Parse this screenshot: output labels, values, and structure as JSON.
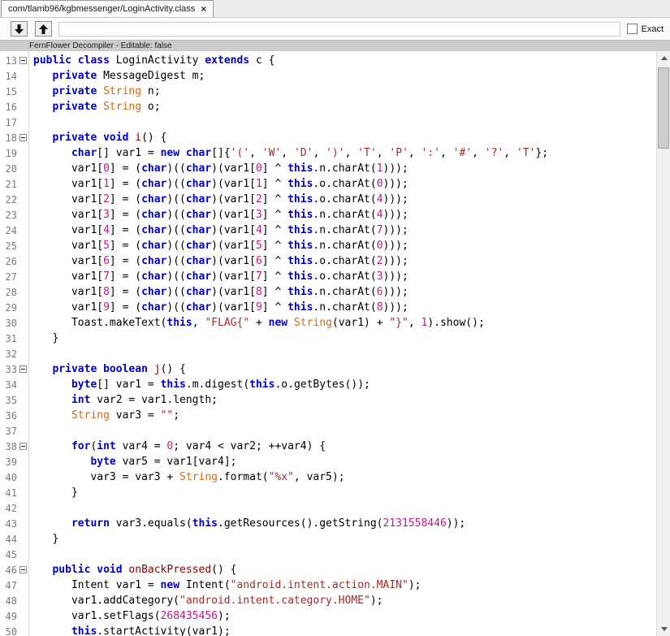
{
  "tab": {
    "title": "com/tlamb96/kgbmessenger/LoginActivity.class",
    "close_glyph": "×"
  },
  "toolbar": {
    "search_value": "",
    "exact_label": "Exact",
    "exact_checked": false
  },
  "decompiler_bar": {
    "label": "FernFlower Decompiler - Editable: false"
  },
  "syntax_colors": {
    "k": "#0000CC",
    "t": "#D2691E",
    "f": "#8B0000",
    "n": "#C71585",
    "s": "#A52A2A",
    "p": "#000000"
  },
  "editor": {
    "first_line": 13,
    "fold_lines": [
      13,
      18,
      33,
      38,
      46
    ],
    "lines": [
      [
        [
          "k",
          "public"
        ],
        [
          "p",
          " "
        ],
        [
          "k",
          "class"
        ],
        [
          "p",
          " LoginActivity "
        ],
        [
          "k",
          "extends"
        ],
        [
          "p",
          " c {"
        ]
      ],
      [
        [
          "p",
          "   "
        ],
        [
          "k",
          "private"
        ],
        [
          "p",
          " MessageDigest m;"
        ]
      ],
      [
        [
          "p",
          "   "
        ],
        [
          "k",
          "private"
        ],
        [
          "p",
          " "
        ],
        [
          "t",
          "String"
        ],
        [
          "p",
          " n;"
        ]
      ],
      [
        [
          "p",
          "   "
        ],
        [
          "k",
          "private"
        ],
        [
          "p",
          " "
        ],
        [
          "t",
          "String"
        ],
        [
          "p",
          " o;"
        ]
      ],
      [],
      [
        [
          "p",
          "   "
        ],
        [
          "k",
          "private"
        ],
        [
          "p",
          " "
        ],
        [
          "k",
          "void"
        ],
        [
          "p",
          " "
        ],
        [
          "f",
          "i"
        ],
        [
          "p",
          "() {"
        ]
      ],
      [
        [
          "p",
          "      "
        ],
        [
          "k",
          "char"
        ],
        [
          "p",
          "[] var1 = "
        ],
        [
          "k",
          "new"
        ],
        [
          "p",
          " "
        ],
        [
          "k",
          "char"
        ],
        [
          "p",
          "[]{"
        ],
        [
          "c",
          "'('"
        ],
        [
          "p",
          ", "
        ],
        [
          "c",
          "'W'"
        ],
        [
          "p",
          ", "
        ],
        [
          "c",
          "'D'"
        ],
        [
          "p",
          ", "
        ],
        [
          "c",
          "')'"
        ],
        [
          "p",
          ", "
        ],
        [
          "c",
          "'T'"
        ],
        [
          "p",
          ", "
        ],
        [
          "c",
          "'P'"
        ],
        [
          "p",
          ", "
        ],
        [
          "c",
          "':'"
        ],
        [
          "p",
          ", "
        ],
        [
          "c",
          "'#'"
        ],
        [
          "p",
          ", "
        ],
        [
          "c",
          "'?'"
        ],
        [
          "p",
          ", "
        ],
        [
          "c",
          "'T'"
        ],
        [
          "p",
          "};"
        ]
      ],
      [
        [
          "p",
          "      var1["
        ],
        [
          "n",
          "0"
        ],
        [
          "p",
          "] = ("
        ],
        [
          "k",
          "char"
        ],
        [
          "p",
          ")(("
        ],
        [
          "k",
          "char"
        ],
        [
          "p",
          ")(var1["
        ],
        [
          "n",
          "0"
        ],
        [
          "p",
          "] ^ "
        ],
        [
          "k",
          "this"
        ],
        [
          "p",
          ".n.charAt("
        ],
        [
          "n",
          "1"
        ],
        [
          "p",
          ")));"
        ]
      ],
      [
        [
          "p",
          "      var1["
        ],
        [
          "n",
          "1"
        ],
        [
          "p",
          "] = ("
        ],
        [
          "k",
          "char"
        ],
        [
          "p",
          ")(("
        ],
        [
          "k",
          "char"
        ],
        [
          "p",
          ")(var1["
        ],
        [
          "n",
          "1"
        ],
        [
          "p",
          "] ^ "
        ],
        [
          "k",
          "this"
        ],
        [
          "p",
          ".o.charAt("
        ],
        [
          "n",
          "0"
        ],
        [
          "p",
          ")));"
        ]
      ],
      [
        [
          "p",
          "      var1["
        ],
        [
          "n",
          "2"
        ],
        [
          "p",
          "] = ("
        ],
        [
          "k",
          "char"
        ],
        [
          "p",
          ")(("
        ],
        [
          "k",
          "char"
        ],
        [
          "p",
          ")(var1["
        ],
        [
          "n",
          "2"
        ],
        [
          "p",
          "] ^ "
        ],
        [
          "k",
          "this"
        ],
        [
          "p",
          ".o.charAt("
        ],
        [
          "n",
          "4"
        ],
        [
          "p",
          ")));"
        ]
      ],
      [
        [
          "p",
          "      var1["
        ],
        [
          "n",
          "3"
        ],
        [
          "p",
          "] = ("
        ],
        [
          "k",
          "char"
        ],
        [
          "p",
          ")(("
        ],
        [
          "k",
          "char"
        ],
        [
          "p",
          ")(var1["
        ],
        [
          "n",
          "3"
        ],
        [
          "p",
          "] ^ "
        ],
        [
          "k",
          "this"
        ],
        [
          "p",
          ".n.charAt("
        ],
        [
          "n",
          "4"
        ],
        [
          "p",
          ")));"
        ]
      ],
      [
        [
          "p",
          "      var1["
        ],
        [
          "n",
          "4"
        ],
        [
          "p",
          "] = ("
        ],
        [
          "k",
          "char"
        ],
        [
          "p",
          ")(("
        ],
        [
          "k",
          "char"
        ],
        [
          "p",
          ")(var1["
        ],
        [
          "n",
          "4"
        ],
        [
          "p",
          "] ^ "
        ],
        [
          "k",
          "this"
        ],
        [
          "p",
          ".n.charAt("
        ],
        [
          "n",
          "7"
        ],
        [
          "p",
          ")));"
        ]
      ],
      [
        [
          "p",
          "      var1["
        ],
        [
          "n",
          "5"
        ],
        [
          "p",
          "] = ("
        ],
        [
          "k",
          "char"
        ],
        [
          "p",
          ")(("
        ],
        [
          "k",
          "char"
        ],
        [
          "p",
          ")(var1["
        ],
        [
          "n",
          "5"
        ],
        [
          "p",
          "] ^ "
        ],
        [
          "k",
          "this"
        ],
        [
          "p",
          ".n.charAt("
        ],
        [
          "n",
          "0"
        ],
        [
          "p",
          ")));"
        ]
      ],
      [
        [
          "p",
          "      var1["
        ],
        [
          "n",
          "6"
        ],
        [
          "p",
          "] = ("
        ],
        [
          "k",
          "char"
        ],
        [
          "p",
          ")(("
        ],
        [
          "k",
          "char"
        ],
        [
          "p",
          ")(var1["
        ],
        [
          "n",
          "6"
        ],
        [
          "p",
          "] ^ "
        ],
        [
          "k",
          "this"
        ],
        [
          "p",
          ".o.charAt("
        ],
        [
          "n",
          "2"
        ],
        [
          "p",
          ")));"
        ]
      ],
      [
        [
          "p",
          "      var1["
        ],
        [
          "n",
          "7"
        ],
        [
          "p",
          "] = ("
        ],
        [
          "k",
          "char"
        ],
        [
          "p",
          ")(("
        ],
        [
          "k",
          "char"
        ],
        [
          "p",
          ")(var1["
        ],
        [
          "n",
          "7"
        ],
        [
          "p",
          "] ^ "
        ],
        [
          "k",
          "this"
        ],
        [
          "p",
          ".o.charAt("
        ],
        [
          "n",
          "3"
        ],
        [
          "p",
          ")));"
        ]
      ],
      [
        [
          "p",
          "      var1["
        ],
        [
          "n",
          "8"
        ],
        [
          "p",
          "] = ("
        ],
        [
          "k",
          "char"
        ],
        [
          "p",
          ")(("
        ],
        [
          "k",
          "char"
        ],
        [
          "p",
          ")(var1["
        ],
        [
          "n",
          "8"
        ],
        [
          "p",
          "] ^ "
        ],
        [
          "k",
          "this"
        ],
        [
          "p",
          ".n.charAt("
        ],
        [
          "n",
          "6"
        ],
        [
          "p",
          ")));"
        ]
      ],
      [
        [
          "p",
          "      var1["
        ],
        [
          "n",
          "9"
        ],
        [
          "p",
          "] = ("
        ],
        [
          "k",
          "char"
        ],
        [
          "p",
          ")(("
        ],
        [
          "k",
          "char"
        ],
        [
          "p",
          ")(var1["
        ],
        [
          "n",
          "9"
        ],
        [
          "p",
          "] ^ "
        ],
        [
          "k",
          "this"
        ],
        [
          "p",
          ".n.charAt("
        ],
        [
          "n",
          "8"
        ],
        [
          "p",
          ")));"
        ]
      ],
      [
        [
          "p",
          "      Toast.makeText("
        ],
        [
          "k",
          "this"
        ],
        [
          "p",
          ", "
        ],
        [
          "s",
          "\"FLAG{\""
        ],
        [
          "p",
          " + "
        ],
        [
          "k",
          "new"
        ],
        [
          "p",
          " "
        ],
        [
          "t",
          "String"
        ],
        [
          "p",
          "(var1) + "
        ],
        [
          "s",
          "\"}\""
        ],
        [
          "p",
          ", "
        ],
        [
          "n",
          "1"
        ],
        [
          "p",
          ").show();"
        ]
      ],
      [
        [
          "p",
          "   }"
        ]
      ],
      [],
      [
        [
          "p",
          "   "
        ],
        [
          "k",
          "private"
        ],
        [
          "p",
          " "
        ],
        [
          "k",
          "boolean"
        ],
        [
          "p",
          " "
        ],
        [
          "f",
          "j"
        ],
        [
          "p",
          "() {"
        ]
      ],
      [
        [
          "p",
          "      "
        ],
        [
          "k",
          "byte"
        ],
        [
          "p",
          "[] var1 = "
        ],
        [
          "k",
          "this"
        ],
        [
          "p",
          ".m.digest("
        ],
        [
          "k",
          "this"
        ],
        [
          "p",
          ".o.getBytes());"
        ]
      ],
      [
        [
          "p",
          "      "
        ],
        [
          "k",
          "int"
        ],
        [
          "p",
          " var2 = var1.length;"
        ]
      ],
      [
        [
          "p",
          "      "
        ],
        [
          "t",
          "String"
        ],
        [
          "p",
          " var3 = "
        ],
        [
          "s",
          "\"\""
        ],
        [
          "p",
          ";"
        ]
      ],
      [],
      [
        [
          "p",
          "      "
        ],
        [
          "k",
          "for"
        ],
        [
          "p",
          "("
        ],
        [
          "k",
          "int"
        ],
        [
          "p",
          " var4 = "
        ],
        [
          "n",
          "0"
        ],
        [
          "p",
          "; var4 < var2; ++var4) {"
        ]
      ],
      [
        [
          "p",
          "         "
        ],
        [
          "k",
          "byte"
        ],
        [
          "p",
          " var5 = var1[var4];"
        ]
      ],
      [
        [
          "p",
          "         var3 = var3 + "
        ],
        [
          "t",
          "String"
        ],
        [
          "p",
          ".format("
        ],
        [
          "s",
          "\"%x\""
        ],
        [
          "p",
          ", var5);"
        ]
      ],
      [
        [
          "p",
          "      }"
        ]
      ],
      [],
      [
        [
          "p",
          "      "
        ],
        [
          "k",
          "return"
        ],
        [
          "p",
          " var3.equals("
        ],
        [
          "k",
          "this"
        ],
        [
          "p",
          ".getResources().getString("
        ],
        [
          "n",
          "2131558446"
        ],
        [
          "p",
          "));"
        ]
      ],
      [
        [
          "p",
          "   }"
        ]
      ],
      [],
      [
        [
          "p",
          "   "
        ],
        [
          "k",
          "public"
        ],
        [
          "p",
          " "
        ],
        [
          "k",
          "void"
        ],
        [
          "p",
          " "
        ],
        [
          "f",
          "onBackPressed"
        ],
        [
          "p",
          "() {"
        ]
      ],
      [
        [
          "p",
          "      Intent var1 = "
        ],
        [
          "k",
          "new"
        ],
        [
          "p",
          " Intent("
        ],
        [
          "s",
          "\"android.intent.action.MAIN\""
        ],
        [
          "p",
          ");"
        ]
      ],
      [
        [
          "p",
          "      var1.addCategory("
        ],
        [
          "s",
          "\"android.intent.category.HOME\""
        ],
        [
          "p",
          ");"
        ]
      ],
      [
        [
          "p",
          "      var1.setFlags("
        ],
        [
          "n",
          "268435456"
        ],
        [
          "p",
          ");"
        ]
      ],
      [
        [
          "p",
          "      "
        ],
        [
          "k",
          "this"
        ],
        [
          "p",
          ".startActivity(var1);"
        ]
      ]
    ]
  }
}
